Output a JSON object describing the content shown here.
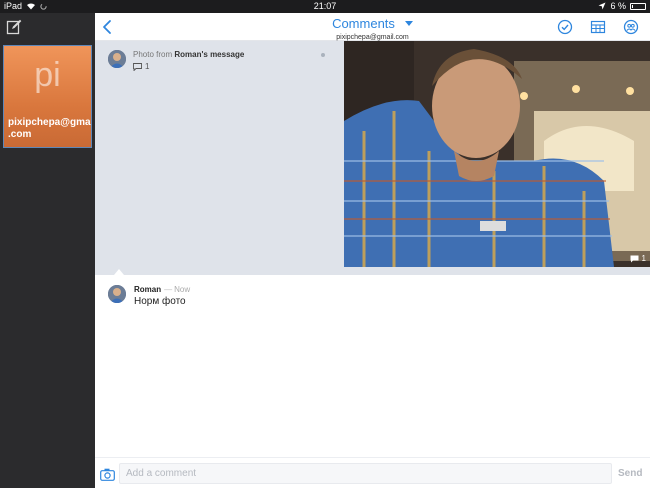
{
  "status_bar": {
    "device": "iPad",
    "time": "21:07",
    "battery_text": "6 %",
    "battery_level_percent": 6
  },
  "sidebar": {
    "account": {
      "initials": "pi",
      "email": "pixipchepa@gmail .com"
    }
  },
  "header": {
    "title": "Comments",
    "subtitle": "pixipchepa@gmail.com"
  },
  "message": {
    "caption_prefix": "Photo from",
    "caption_source": "Roman's message",
    "comment_count": "1",
    "photo_comment_count": "1"
  },
  "comment": {
    "author": "Roman",
    "separator": "—",
    "time": "Now",
    "text": "Норм фото"
  },
  "composer": {
    "placeholder": "Add a comment",
    "send_label": "Send"
  },
  "colors": {
    "accent": "#2e86de",
    "tile": "#e0813f",
    "message_bg": "#dfe3ea"
  },
  "icons": [
    "compose-icon",
    "back-icon",
    "checkmark-icon",
    "calendar-grid-icon",
    "people-icon",
    "comment-bubble-icon",
    "camera-icon"
  ]
}
